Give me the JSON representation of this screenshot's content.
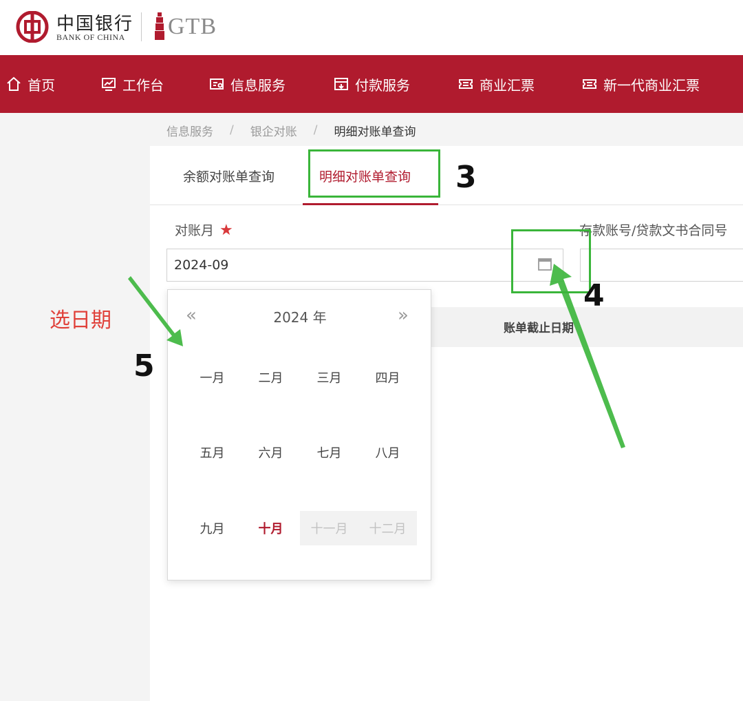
{
  "brand": {
    "name_cn": "中国银行",
    "name_en": "BANK OF CHINA",
    "product": "GTB"
  },
  "nav": [
    {
      "label": "首页",
      "icon": "home-icon"
    },
    {
      "label": "工作台",
      "icon": "dashboard-icon"
    },
    {
      "label": "信息服务",
      "icon": "info-service-icon"
    },
    {
      "label": "付款服务",
      "icon": "payment-icon"
    },
    {
      "label": "商业汇票",
      "icon": "ticket-icon"
    },
    {
      "label": "新一代商业汇票",
      "icon": "ticket-icon"
    }
  ],
  "breadcrumb": {
    "items": [
      "信息服务",
      "银企对账",
      "明细对账单查询"
    ],
    "separator": "/"
  },
  "tabs": [
    {
      "label": "余额对账单查询",
      "active": false
    },
    {
      "label": "明细对账单查询",
      "active": true
    }
  ],
  "form": {
    "month_label": "对账月",
    "required_mark": "★",
    "month_value": "2024-09",
    "account_label": "存款账号/贷款文书合同号"
  },
  "table": {
    "cutoff_column": "账单截止日期"
  },
  "month_picker": {
    "year_label": "2024 年",
    "prev_symbol": "«",
    "next_symbol": "»",
    "months": [
      {
        "label": "一月",
        "state": "normal"
      },
      {
        "label": "二月",
        "state": "normal"
      },
      {
        "label": "三月",
        "state": "normal"
      },
      {
        "label": "四月",
        "state": "normal"
      },
      {
        "label": "五月",
        "state": "normal"
      },
      {
        "label": "六月",
        "state": "normal"
      },
      {
        "label": "七月",
        "state": "normal"
      },
      {
        "label": "八月",
        "state": "normal"
      },
      {
        "label": "九月",
        "state": "normal"
      },
      {
        "label": "十月",
        "state": "current"
      },
      {
        "label": "十一月",
        "state": "disabled"
      },
      {
        "label": "十二月",
        "state": "disabled"
      }
    ]
  },
  "annotations": {
    "step3": "3",
    "step4": "4",
    "step5": "5",
    "note": "选日期",
    "color": "#3ab53a",
    "note_color": "#e0413a"
  },
  "theme": {
    "brand_red": "#b01b2e"
  }
}
